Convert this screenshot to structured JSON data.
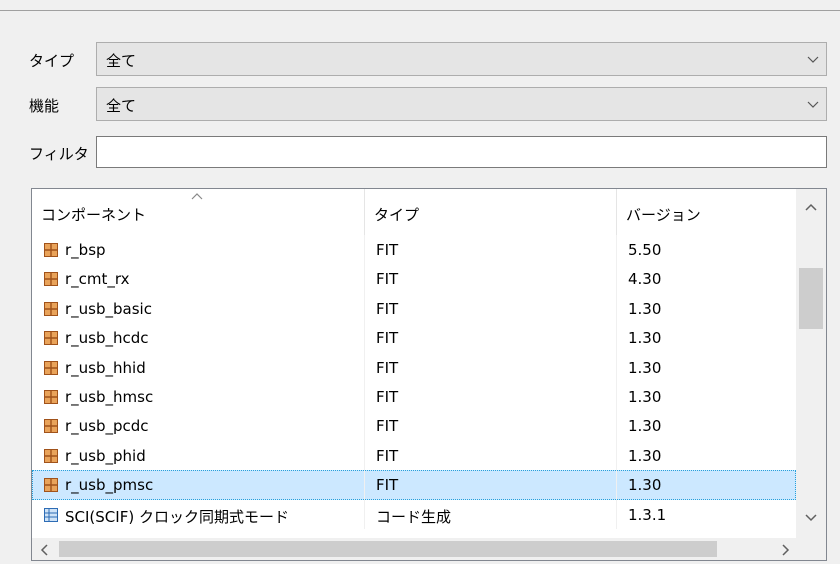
{
  "type_filter": {
    "label": "タイプ",
    "value": "全て"
  },
  "function_filter": {
    "label": "機能",
    "value": "全て"
  },
  "text_filter": {
    "label": "フィルタ",
    "value": ""
  },
  "columns": [
    "コンポーネント",
    "タイプ",
    "バージョン"
  ],
  "rows": [
    {
      "name": "r_bsp",
      "type": "FIT",
      "version": "5.50",
      "icon": "component-grid-icon"
    },
    {
      "name": "r_cmt_rx",
      "type": "FIT",
      "version": "4.30",
      "icon": "component-grid-icon"
    },
    {
      "name": "r_usb_basic",
      "type": "FIT",
      "version": "1.30",
      "icon": "component-grid-icon"
    },
    {
      "name": "r_usb_hcdc",
      "type": "FIT",
      "version": "1.30",
      "icon": "component-grid-icon"
    },
    {
      "name": "r_usb_hhid",
      "type": "FIT",
      "version": "1.30",
      "icon": "component-grid-icon"
    },
    {
      "name": "r_usb_hmsc",
      "type": "FIT",
      "version": "1.30",
      "icon": "component-grid-icon"
    },
    {
      "name": "r_usb_pcdc",
      "type": "FIT",
      "version": "1.30",
      "icon": "component-grid-icon"
    },
    {
      "name": "r_usb_phid",
      "type": "FIT",
      "version": "1.30",
      "icon": "component-grid-icon"
    },
    {
      "name": "r_usb_pmsc",
      "type": "FIT",
      "version": "1.30",
      "icon": "component-grid-icon",
      "selected": true
    }
  ],
  "partial_row": {
    "name": "SCI(SCIF) クロック同期式モード",
    "type": "コード生成",
    "version": "1.3.1",
    "icon": "code-generator-icon"
  },
  "colors": {
    "selection": "#cce8ff",
    "selection_border": "#26a0da",
    "icon_orange": "#c06a18"
  }
}
